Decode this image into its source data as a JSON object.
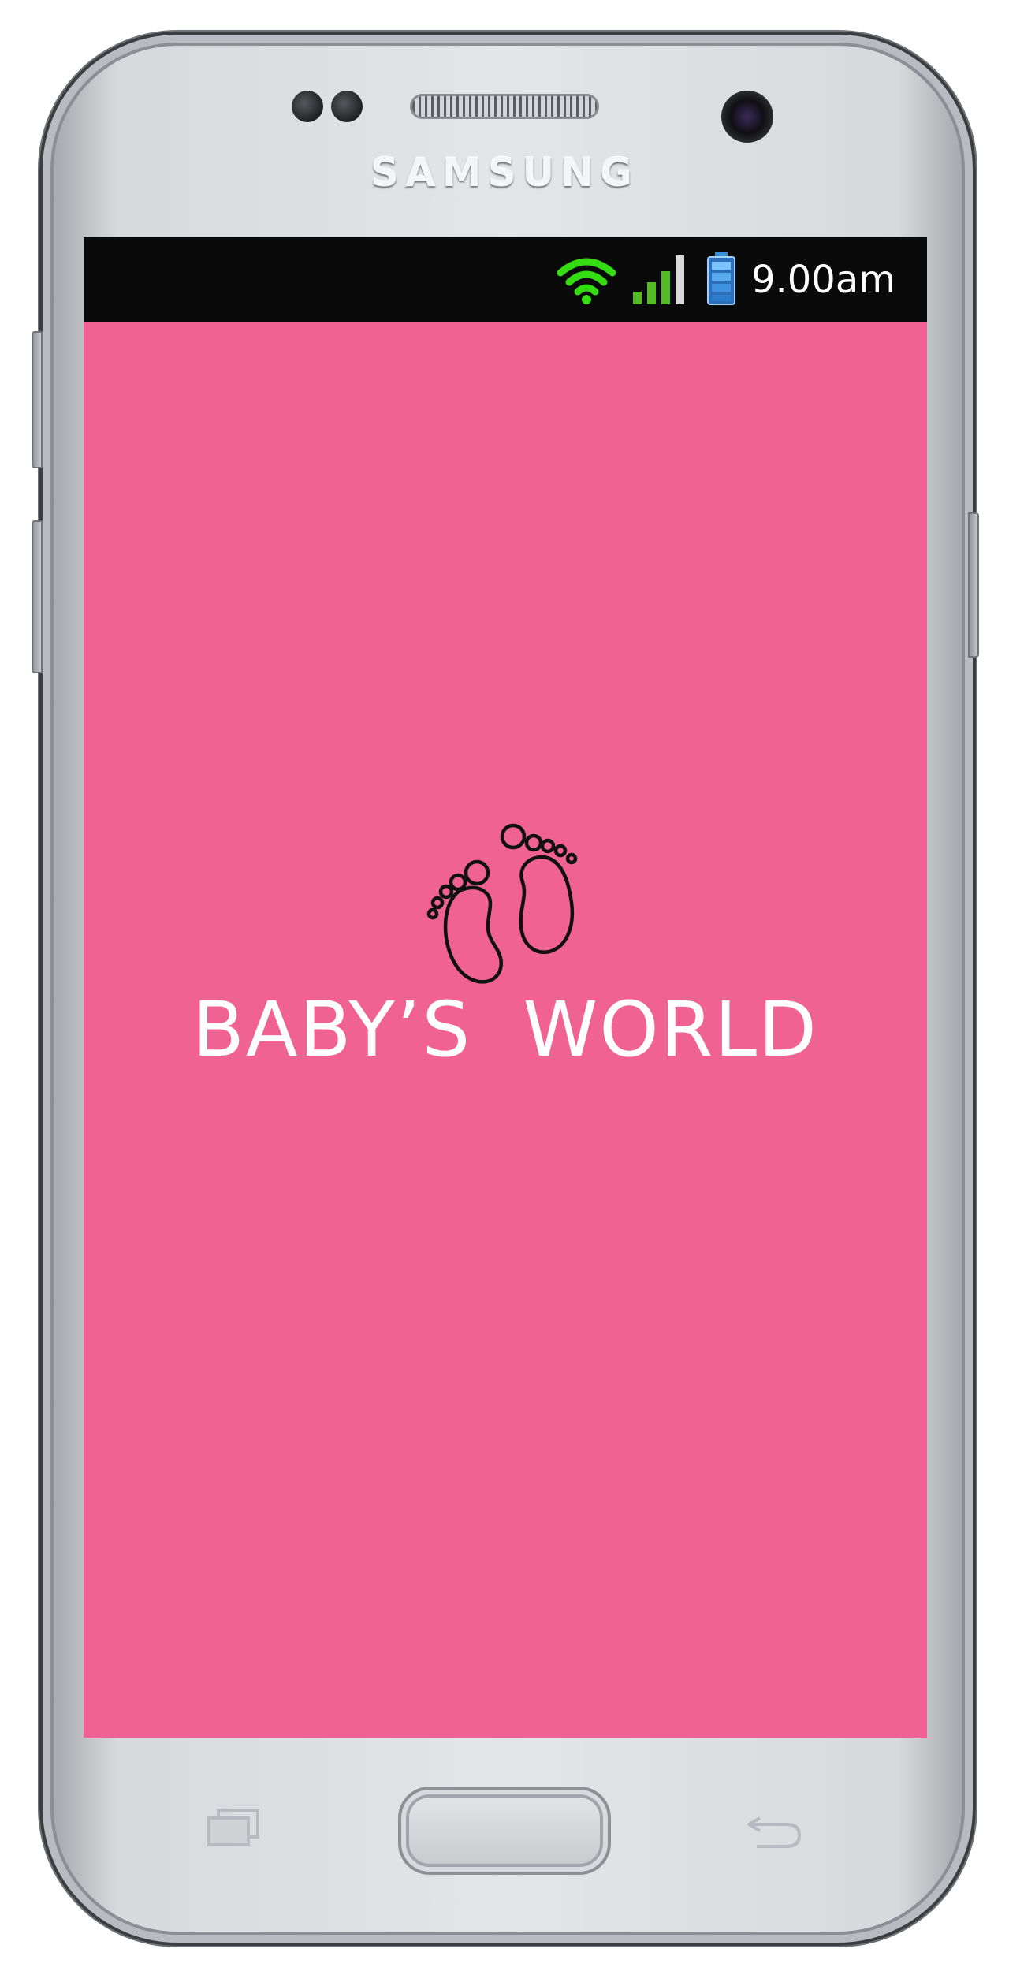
{
  "device": {
    "brand": "SAMSUNG"
  },
  "status_bar": {
    "time": "9.00am",
    "icons": [
      "wifi-icon",
      "signal-icon",
      "battery-icon"
    ],
    "wifi_color": "#33dd11",
    "signal_color": "#55bb22",
    "battery_color": "#3a8fdc"
  },
  "splash": {
    "background": "#f06292",
    "title": "BABY’S  WORLD",
    "logo_icon": "baby-feet-icon"
  },
  "navigation": {
    "buttons": [
      "recent-apps-icon",
      "home-button",
      "back-icon"
    ]
  }
}
